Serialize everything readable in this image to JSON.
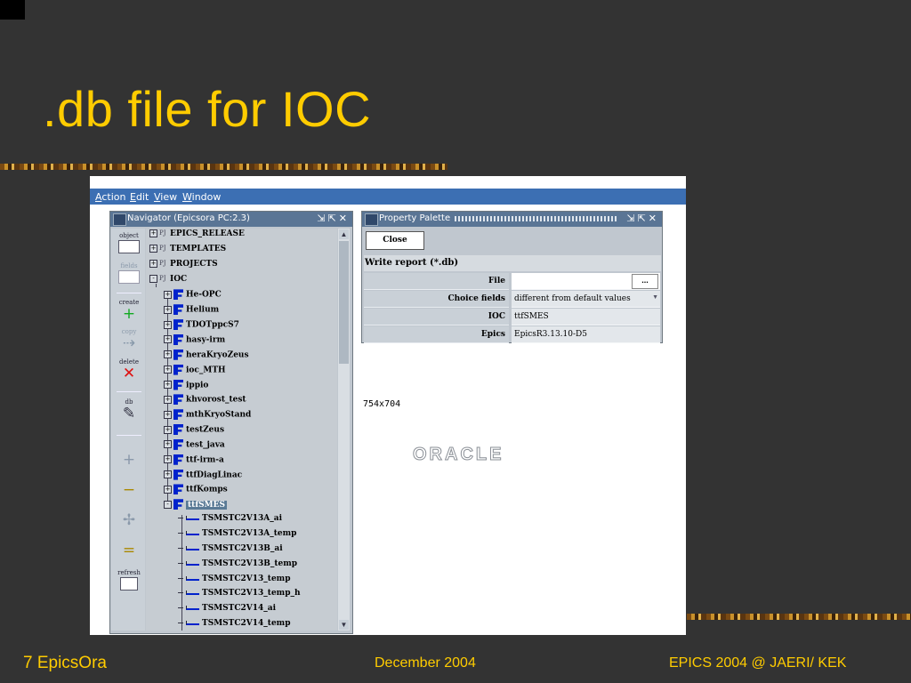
{
  "slide": {
    "title": ".db file for IOC",
    "footer_left": "7 EpicsOra",
    "footer_center": "December 2004",
    "footer_right": "EPICS 2004 @ JAERI/ KEK"
  },
  "menubar": [
    "Action",
    "Edit",
    "View",
    "Window"
  ],
  "navigator": {
    "title": "Navigator  (Epicsora PC:2.3)",
    "toolbar": [
      {
        "label": "object",
        "icon": "object-icon"
      },
      {
        "label": "fields",
        "icon": "fields-icon"
      },
      {
        "label": "create",
        "icon": "plus-icon"
      },
      {
        "label": "copy",
        "icon": "copy-icon"
      },
      {
        "label": "delete",
        "icon": "x-icon"
      },
      {
        "label": "db",
        "icon": "db-edit-icon"
      },
      {
        "label": "",
        "icon": "expand-icon"
      },
      {
        "label": "",
        "icon": "collapse-icon"
      },
      {
        "label": "",
        "icon": "expand-all-icon"
      },
      {
        "label": "",
        "icon": "collapse-all-icon"
      },
      {
        "label": "refresh",
        "icon": "refresh-icon"
      }
    ],
    "tree": [
      {
        "text": "EPICS_RELEASE",
        "kind": "project",
        "level": 0,
        "expander": "+"
      },
      {
        "text": "TEMPLATES",
        "kind": "project",
        "level": 0,
        "expander": "+"
      },
      {
        "text": "PROJECTS",
        "kind": "project",
        "level": 0,
        "expander": "+"
      },
      {
        "text": "IOC",
        "kind": "project",
        "level": 0,
        "expander": "-"
      },
      {
        "text": "He-OPC",
        "kind": "ioc",
        "level": 1,
        "expander": "+"
      },
      {
        "text": "Helium",
        "kind": "ioc",
        "level": 1,
        "expander": "+"
      },
      {
        "text": "TDOTppcS7",
        "kind": "ioc",
        "level": 1,
        "expander": "+"
      },
      {
        "text": "hasy-irm",
        "kind": "ioc",
        "level": 1,
        "expander": "+"
      },
      {
        "text": "heraKryoZeus",
        "kind": "ioc",
        "level": 1,
        "expander": "+"
      },
      {
        "text": "ioc_MTH",
        "kind": "ioc",
        "level": 1,
        "expander": "+"
      },
      {
        "text": "ippio",
        "kind": "ioc",
        "level": 1,
        "expander": "+"
      },
      {
        "text": "khvorost_test",
        "kind": "ioc",
        "level": 1,
        "expander": "+"
      },
      {
        "text": "mthKryoStand",
        "kind": "ioc",
        "level": 1,
        "expander": "+"
      },
      {
        "text": "testZeus",
        "kind": "ioc",
        "level": 1,
        "expander": "+"
      },
      {
        "text": "test_java",
        "kind": "ioc",
        "level": 1,
        "expander": "+"
      },
      {
        "text": "ttf-irm-a",
        "kind": "ioc",
        "level": 1,
        "expander": "+"
      },
      {
        "text": "ttfDiagLinac",
        "kind": "ioc",
        "level": 1,
        "expander": "+"
      },
      {
        "text": "ttfKomps",
        "kind": "ioc",
        "level": 1,
        "expander": "+"
      },
      {
        "text": "ttfSMES",
        "kind": "ioc",
        "level": 1,
        "expander": "-",
        "selected": true
      },
      {
        "text": "TSMSTC2V13A_ai",
        "kind": "record",
        "level": 2
      },
      {
        "text": "TSMSTC2V13A_temp",
        "kind": "record",
        "level": 2
      },
      {
        "text": "TSMSTC2V13B_ai",
        "kind": "record",
        "level": 2
      },
      {
        "text": "TSMSTC2V13B_temp",
        "kind": "record",
        "level": 2
      },
      {
        "text": "TSMSTC2V13_temp",
        "kind": "record",
        "level": 2
      },
      {
        "text": "TSMSTC2V13_temp_h",
        "kind": "record",
        "level": 2
      },
      {
        "text": "TSMSTC2V14_ai",
        "kind": "record",
        "level": 2
      },
      {
        "text": "TSMSTC2V14_temp",
        "kind": "record",
        "level": 2
      }
    ]
  },
  "palette": {
    "title": "Property Palette",
    "close_label": "Close",
    "section": "Write report (*.db)",
    "rows": [
      {
        "label": "File",
        "value": "",
        "control": "button",
        "button": "..."
      },
      {
        "label": "Choice fields",
        "value": "different from default values",
        "control": "dropdown"
      },
      {
        "label": "IOC",
        "value": "ttfSMES",
        "control": "text"
      },
      {
        "label": "Epics",
        "value": "EpicsR3.13.10-D5",
        "control": "text"
      }
    ]
  },
  "canvas": {
    "dims_text": "754x704",
    "logo_text": "ORACLE"
  },
  "colors": {
    "slide_bg": "#333333",
    "title": "#ffcc00",
    "window_bg": "#c0c7cf",
    "titlebar": "#5a7595",
    "flag_blue": "#0022cc"
  }
}
